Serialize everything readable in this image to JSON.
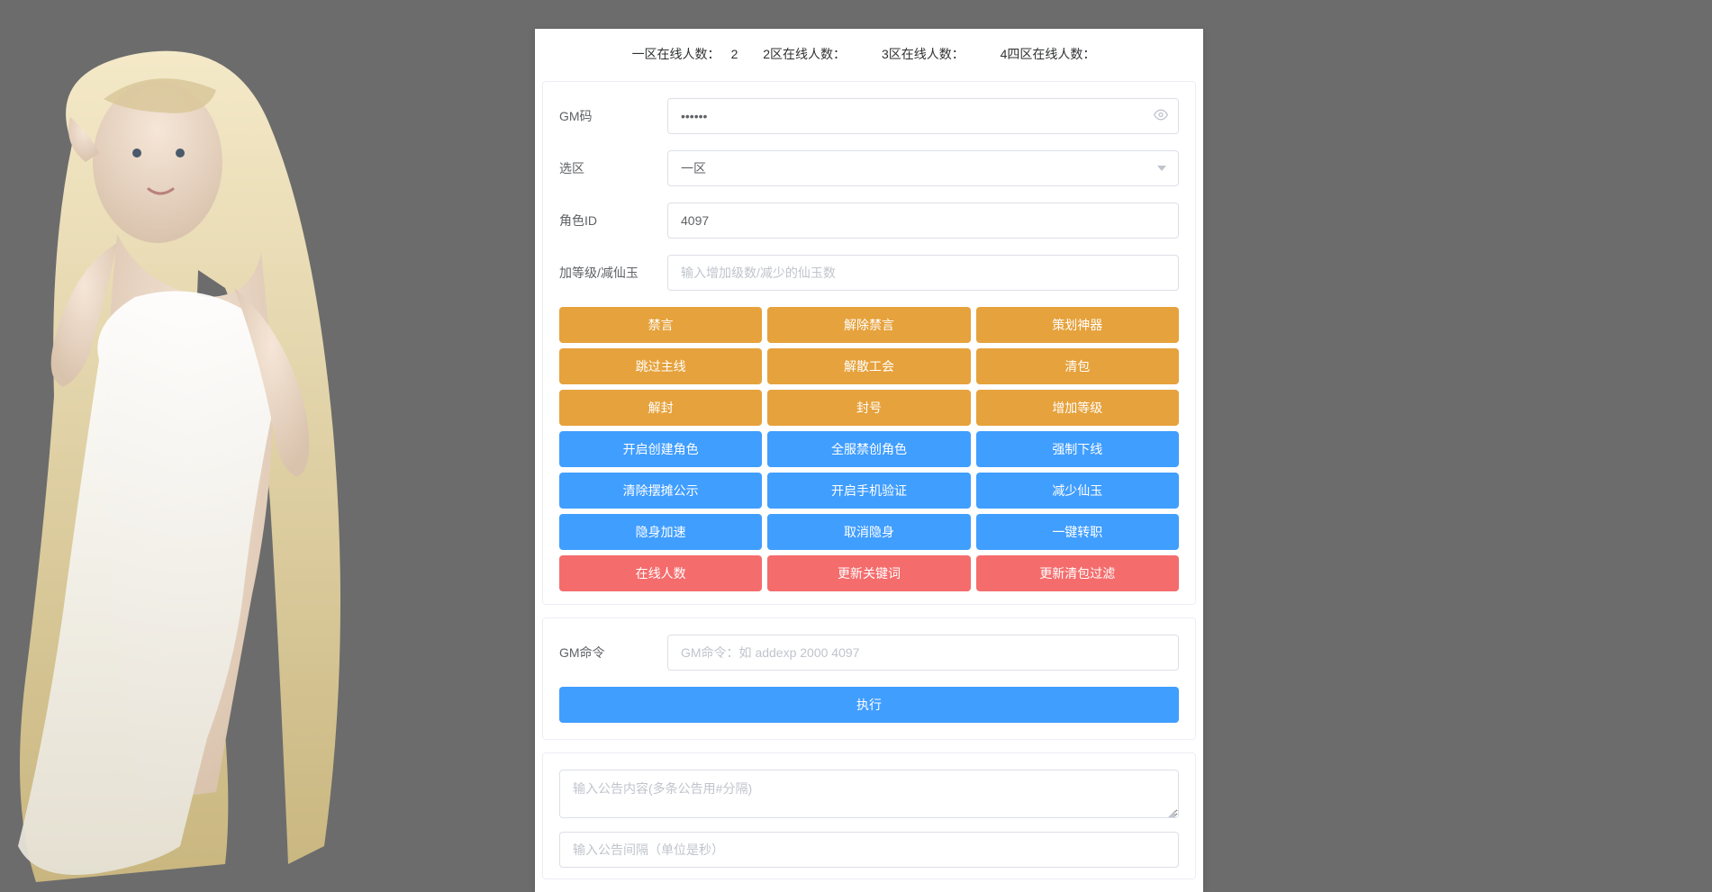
{
  "stats": {
    "zone1_label": "一区在线人数：",
    "zone1_value": "2",
    "zone2_label": "2区在线人数：",
    "zone2_value": "",
    "zone3_label": "3区在线人数：",
    "zone3_value": "",
    "zone4_label": "4四区在线人数：",
    "zone4_value": ""
  },
  "form": {
    "gm_code_label": "GM码",
    "gm_code_value": "••••••",
    "zone_label": "选区",
    "zone_selected": "一区",
    "role_id_label": "角色ID",
    "role_id_value": "4097",
    "level_jade_label": "加等级/减仙玉",
    "level_jade_placeholder": "输入增加级数/减少的仙玉数"
  },
  "buttons": {
    "warn": [
      [
        "禁言",
        "解除禁言",
        "策划神器"
      ],
      [
        "跳过主线",
        "解散工会",
        "清包"
      ],
      [
        "解封",
        "封号",
        "增加等级"
      ]
    ],
    "prim": [
      [
        "开启创建角色",
        "全服禁创角色",
        "强制下线"
      ],
      [
        "清除摆摊公示",
        "开启手机验证",
        "减少仙玉"
      ],
      [
        "隐身加速",
        "取消隐身",
        "一键转职"
      ]
    ],
    "dang": [
      [
        "在线人数",
        "更新关键词",
        "更新清包过滤"
      ]
    ]
  },
  "cmd": {
    "label": "GM命令",
    "placeholder": "GM命令：如 addexp 2000 4097",
    "exec_label": "执行"
  },
  "notice": {
    "content_placeholder": "输入公告内容(多条公告用#分隔)",
    "interval_placeholder": "输入公告间隔（单位是秒）"
  }
}
